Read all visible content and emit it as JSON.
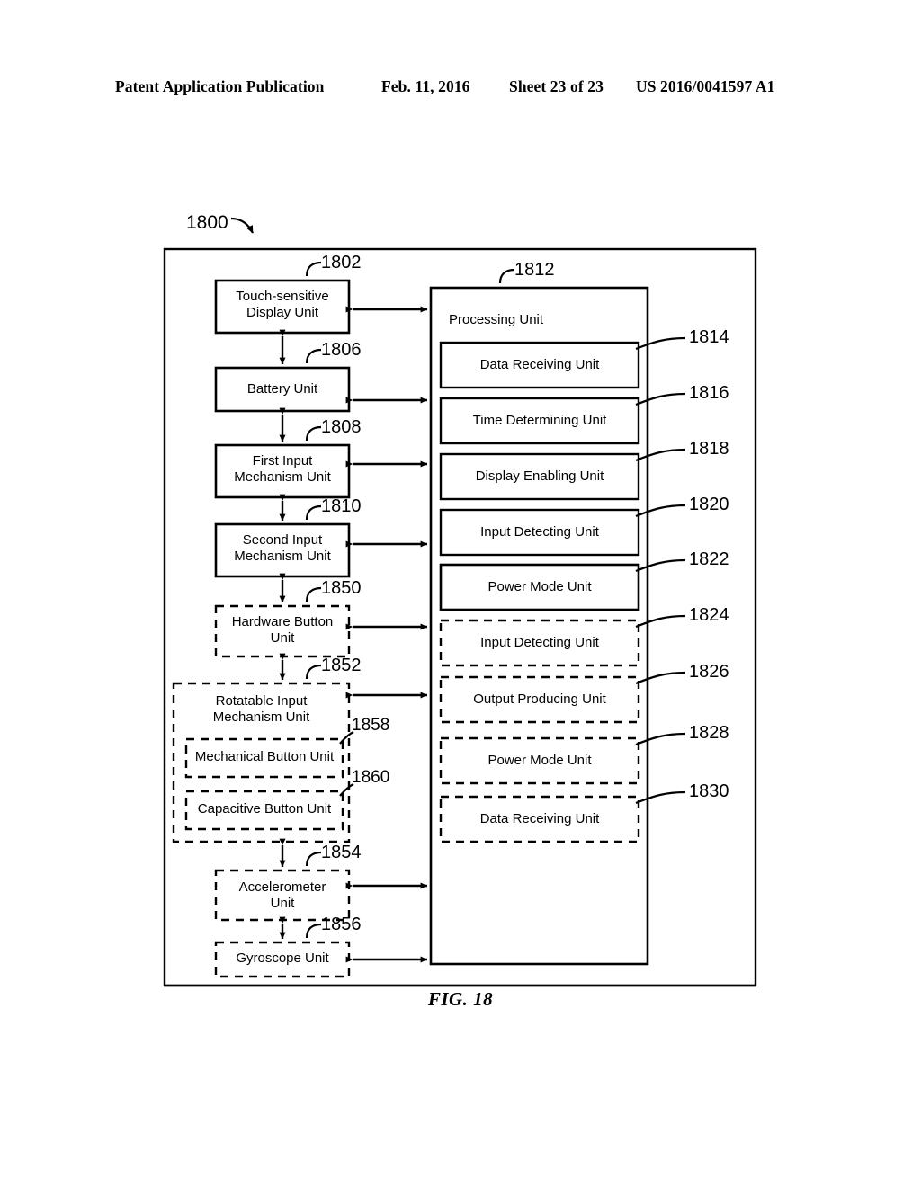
{
  "header": {
    "publication": "Patent Application Publication",
    "date": "Feb. 11, 2016",
    "sheet": "Sheet 23 of 23",
    "patent_number": "US 2016/0041597 A1"
  },
  "figure": {
    "caption": "FIG. 18",
    "system_ref": "1800"
  },
  "left_column": {
    "blocks": [
      {
        "ref": "1802",
        "label": "Touch-sensitive\nDisplay Unit",
        "style": "solid"
      },
      {
        "ref": "1806",
        "label": "Battery Unit",
        "style": "solid"
      },
      {
        "ref": "1808",
        "label": "First Input\nMechanism Unit",
        "style": "solid"
      },
      {
        "ref": "1810",
        "label": "Second Input\nMechanism Unit",
        "style": "solid"
      },
      {
        "ref": "1850",
        "label": "Hardware Button\nUnit",
        "style": "dashed"
      },
      {
        "ref": "1852",
        "label": "Rotatable Input\nMechanism Unit",
        "style": "dashed"
      },
      {
        "ref": "1858",
        "label": "Mechanical Button Unit",
        "style": "dashed"
      },
      {
        "ref": "1860",
        "label": "Capacitive Button Unit",
        "style": "dashed"
      },
      {
        "ref": "1854",
        "label": "Accelerometer\nUnit",
        "style": "dashed"
      },
      {
        "ref": "1856",
        "label": "Gyroscope Unit",
        "style": "dashed"
      }
    ]
  },
  "processing_unit": {
    "ref": "1812",
    "label": "Processing Unit",
    "subunits": [
      {
        "ref": "1814",
        "label": "Data Receiving Unit",
        "style": "solid"
      },
      {
        "ref": "1816",
        "label": "Time Determining Unit",
        "style": "solid"
      },
      {
        "ref": "1818",
        "label": "Display Enabling Unit",
        "style": "solid"
      },
      {
        "ref": "1820",
        "label": "Input Detecting Unit",
        "style": "solid"
      },
      {
        "ref": "1822",
        "label": "Power Mode Unit",
        "style": "solid"
      },
      {
        "ref": "1824",
        "label": "Input Detecting Unit",
        "style": "dashed"
      },
      {
        "ref": "1826",
        "label": "Output Producing Unit",
        "style": "dashed"
      },
      {
        "ref": "1828",
        "label": "Power Mode Unit",
        "style": "dashed"
      },
      {
        "ref": "1830",
        "label": "Data Receiving Unit",
        "style": "dashed"
      }
    ]
  },
  "colors": {
    "ink": "#000000",
    "paper": "#ffffff"
  }
}
